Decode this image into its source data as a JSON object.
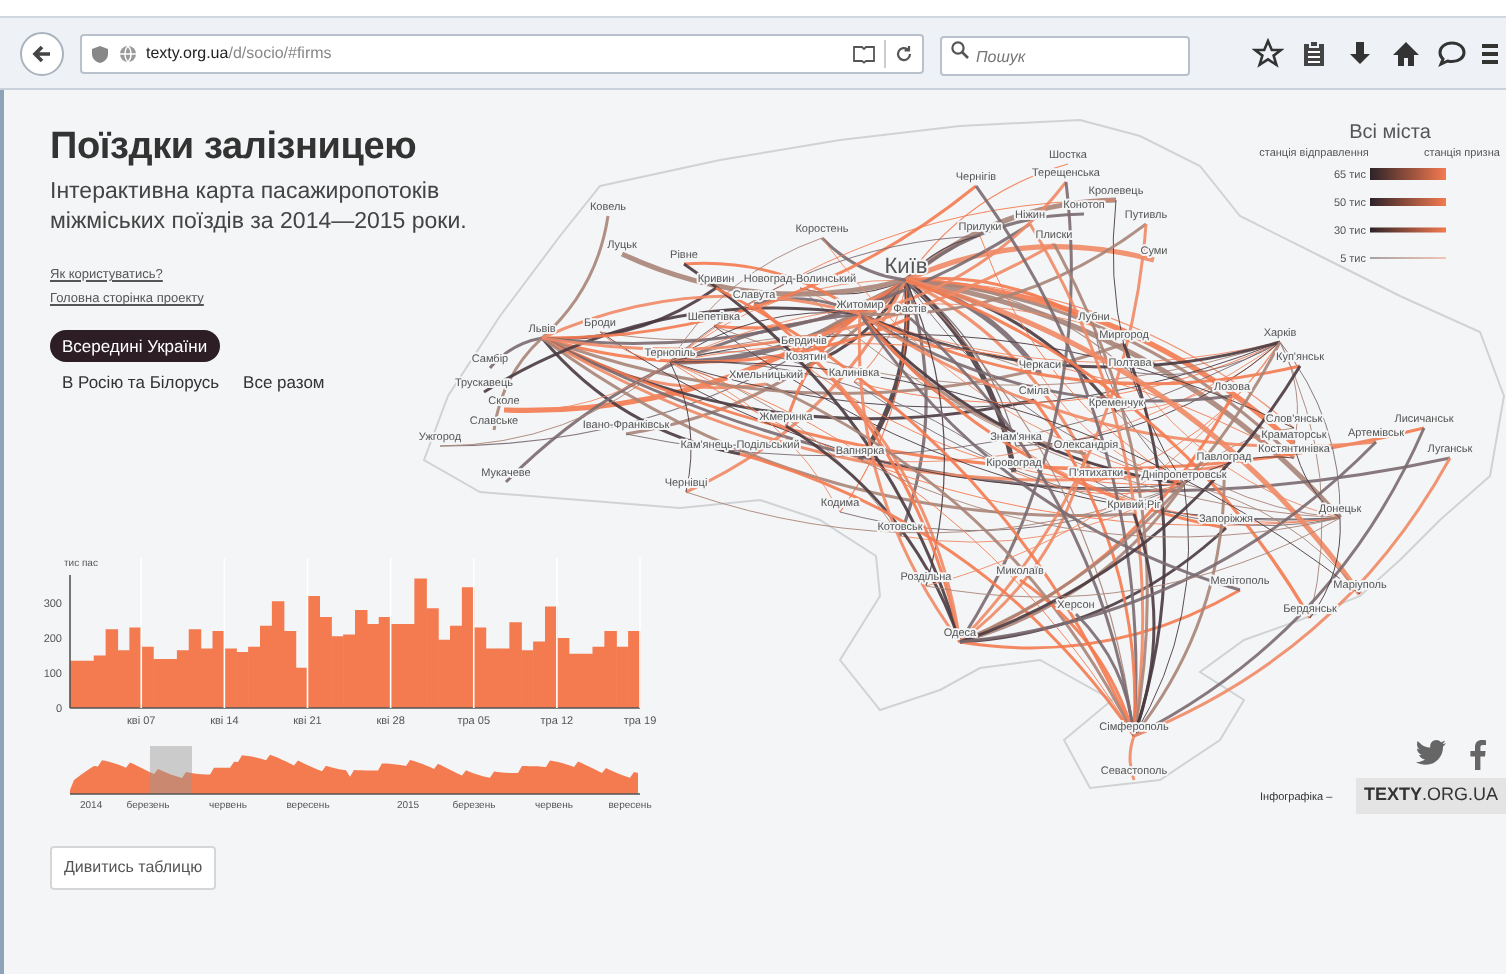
{
  "browser": {
    "url_host": "texty.org.ua",
    "url_path": "/d/socio/#firms",
    "search": {
      "placeholder": "Пошук"
    }
  },
  "page": {
    "title": "Поїздки залізницею",
    "subtitle": "Інтерактивна карта пасажиропотоків міжміських поїздів за 2014—2015 роки.",
    "links": [
      "Як користуватись?",
      "Головна сторінка проекту"
    ],
    "filters": [
      {
        "label": "Всередині України",
        "selected": true
      },
      {
        "label": "В Росію та Білорусь",
        "selected": false
      },
      {
        "label": "Все разом",
        "selected": false
      }
    ]
  },
  "map": {
    "legend": {
      "title": "Всі міста",
      "from_label": "станція відправлення",
      "to_label": "станція призна",
      "sizes": [
        "65 тис",
        "50 тис",
        "30 тис",
        "5 тис"
      ]
    },
    "cities": [
      {
        "name": "Київ",
        "kind": "major"
      },
      {
        "name": "Ковель",
        "kind": "minor"
      },
      {
        "name": "Луцьк",
        "kind": "minor"
      },
      {
        "name": "Рівне",
        "kind": "minor"
      },
      {
        "name": "Коростень",
        "kind": "minor"
      },
      {
        "name": "Кривин",
        "kind": "minor"
      },
      {
        "name": "Новоград-Волинський",
        "kind": "minor"
      },
      {
        "name": "Славута",
        "kind": "minor"
      },
      {
        "name": "Житомир",
        "kind": "minor"
      },
      {
        "name": "Фастів",
        "kind": "minor"
      },
      {
        "name": "Шепетівка",
        "kind": "minor"
      },
      {
        "name": "Львів",
        "kind": "minor"
      },
      {
        "name": "Броди",
        "kind": "minor"
      },
      {
        "name": "Самбір",
        "kind": "minor"
      },
      {
        "name": "Тернопіль",
        "kind": "minor"
      },
      {
        "name": "Бердичів",
        "kind": "minor"
      },
      {
        "name": "Козятин",
        "kind": "minor"
      },
      {
        "name": "Хмельницький",
        "kind": "minor"
      },
      {
        "name": "Калинівка",
        "kind": "minor"
      },
      {
        "name": "Трускавець",
        "kind": "minor"
      },
      {
        "name": "Сколе",
        "kind": "minor"
      },
      {
        "name": "Славське",
        "kind": "minor"
      },
      {
        "name": "Івано-Франківськ",
        "kind": "minor"
      },
      {
        "name": "Жмеринка",
        "kind": "minor"
      },
      {
        "name": "Ужгород",
        "kind": "minor"
      },
      {
        "name": "Кам'янець-Подільський",
        "kind": "minor"
      },
      {
        "name": "Вапнярка",
        "kind": "minor"
      },
      {
        "name": "Мукачеве",
        "kind": "minor"
      },
      {
        "name": "Чернівці",
        "kind": "minor"
      },
      {
        "name": "Чернігів",
        "kind": "minor"
      },
      {
        "name": "Шостка",
        "kind": "minor"
      },
      {
        "name": "Терещенська",
        "kind": "minor"
      },
      {
        "name": "Кролевець",
        "kind": "minor"
      },
      {
        "name": "Ніжин",
        "kind": "minor"
      },
      {
        "name": "Конотоп",
        "kind": "minor"
      },
      {
        "name": "Путивль",
        "kind": "minor"
      },
      {
        "name": "Прилуки",
        "kind": "minor"
      },
      {
        "name": "Плиски",
        "kind": "minor"
      },
      {
        "name": "Суми",
        "kind": "minor"
      },
      {
        "name": "Харків",
        "kind": "minor"
      },
      {
        "name": "Лубни",
        "kind": "minor"
      },
      {
        "name": "Миргород",
        "kind": "minor"
      },
      {
        "name": "Полтава",
        "kind": "minor"
      },
      {
        "name": "Куп'янськ",
        "kind": "minor"
      },
      {
        "name": "Черкаси",
        "kind": "minor"
      },
      {
        "name": "Сміла",
        "kind": "minor"
      },
      {
        "name": "Кременчук",
        "kind": "minor"
      },
      {
        "name": "Лозова",
        "kind": "minor"
      },
      {
        "name": "Слов'янськ",
        "kind": "minor"
      },
      {
        "name": "Лисичанськ",
        "kind": "minor"
      },
      {
        "name": "Краматорськ",
        "kind": "minor"
      },
      {
        "name": "Артемівськ",
        "kind": "minor"
      },
      {
        "name": "Костянтинівка",
        "kind": "minor"
      },
      {
        "name": "Луганськ",
        "kind": "minor"
      },
      {
        "name": "Знам'янка",
        "kind": "minor"
      },
      {
        "name": "Олександрія",
        "kind": "minor"
      },
      {
        "name": "Кіровоград",
        "kind": "minor"
      },
      {
        "name": "Павлоград",
        "kind": "minor"
      },
      {
        "name": "П'ятихатки",
        "kind": "minor"
      },
      {
        "name": "Дніпропетровськ",
        "kind": "minor"
      },
      {
        "name": "Кодима",
        "kind": "minor"
      },
      {
        "name": "Кривий Ріг",
        "kind": "minor"
      },
      {
        "name": "Донецьк",
        "kind": "minor"
      },
      {
        "name": "Запоріжжя",
        "kind": "minor"
      },
      {
        "name": "Котовськ",
        "kind": "minor"
      },
      {
        "name": "Миколаїв",
        "kind": "minor"
      },
      {
        "name": "Роздільна",
        "kind": "minor"
      },
      {
        "name": "Мелітополь",
        "kind": "minor"
      },
      {
        "name": "Маріуполь",
        "kind": "minor"
      },
      {
        "name": "Херсон",
        "kind": "minor"
      },
      {
        "name": "Бердянськ",
        "kind": "minor"
      },
      {
        "name": "Одеса",
        "kind": "minor"
      },
      {
        "name": "Сімферополь",
        "kind": "minor"
      },
      {
        "name": "Севастополь",
        "kind": "minor"
      }
    ]
  },
  "chart": {
    "chart_data": {
      "type": "bar",
      "ylabel": "тис пас",
      "categories": [
        null,
        null,
        null,
        null,
        null,
        null,
        "кві 07",
        null,
        null,
        null,
        null,
        null,
        null,
        "кві 14",
        null,
        null,
        null,
        null,
        null,
        null,
        "кві 21",
        null,
        null,
        null,
        null,
        null,
        null,
        "кві 28",
        null,
        null,
        null,
        null,
        null,
        null,
        "тра 05",
        null,
        null,
        null,
        null,
        null,
        null,
        "тра 12",
        null,
        null,
        null,
        null,
        null,
        null,
        "тра 19"
      ],
      "values": [
        135,
        135,
        150,
        225,
        165,
        230,
        175,
        140,
        140,
        165,
        225,
        170,
        220,
        170,
        160,
        175,
        235,
        305,
        220,
        115,
        320,
        260,
        205,
        210,
        280,
        240,
        260,
        240,
        240,
        370,
        285,
        195,
        235,
        345,
        230,
        170,
        170,
        245,
        165,
        190,
        290,
        200,
        155,
        155,
        175,
        220,
        175,
        220,
        null
      ],
      "ylim": [
        0,
        380
      ],
      "yticks": [
        0,
        100,
        200,
        300
      ],
      "grid": true
    }
  },
  "timeline": {
    "labels": [
      "2014",
      "березень",
      "червень",
      "вересень",
      "2015",
      "березень",
      "червень",
      "вересень"
    ]
  },
  "table_button": "Дивитись таблицю",
  "footer": {
    "credit": "Інфографіка –",
    "brand": "**TEXTY**.ORG.UA"
  }
}
